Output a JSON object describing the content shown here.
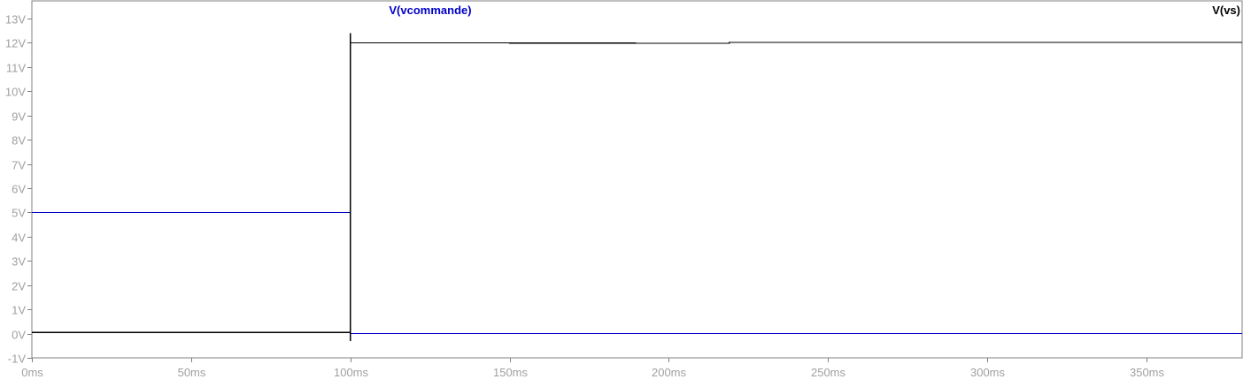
{
  "window": {
    "background": "#ffffff",
    "axis_color": "#808080",
    "tick_label_color": "#a0a0a0"
  },
  "traces": [
    {
      "name": "V(vcommande)",
      "color": "#0000c8"
    },
    {
      "name": "V(vs)",
      "color": "#000000"
    }
  ],
  "chart_data": {
    "type": "line",
    "title": "",
    "xlabel": "",
    "ylabel": "",
    "xlim": [
      0,
      380
    ],
    "ylim": [
      -1,
      13
    ],
    "x_unit": "ms",
    "y_unit": "V",
    "x_ticks": [
      0,
      50,
      100,
      150,
      200,
      250,
      300,
      350
    ],
    "x_tick_labels": [
      "0ms",
      "50ms",
      "100ms",
      "150ms",
      "200ms",
      "250ms",
      "300ms",
      "350ms"
    ],
    "y_ticks": [
      -1,
      0,
      1,
      2,
      3,
      4,
      5,
      6,
      7,
      8,
      9,
      10,
      11,
      12,
      13
    ],
    "y_tick_labels": [
      "-1V",
      "0V",
      "1V",
      "2V",
      "3V",
      "4V",
      "5V",
      "6V",
      "7V",
      "8V",
      "9V",
      "10V",
      "11V",
      "12V",
      "13V"
    ],
    "grid": false,
    "series": [
      {
        "name": "V(vcommande)",
        "color": "#0000c8",
        "x": [
          0,
          100,
          100,
          380
        ],
        "y": [
          5,
          5,
          0,
          0
        ]
      },
      {
        "name": "V(vs)",
        "color": "#000000",
        "x": [
          0,
          100,
          100,
          100,
          100,
          219,
          219,
          380
        ],
        "y": [
          0.05,
          0.05,
          -0.3,
          12.4,
          12,
          11.98,
          12.02,
          12.02
        ]
      }
    ]
  }
}
